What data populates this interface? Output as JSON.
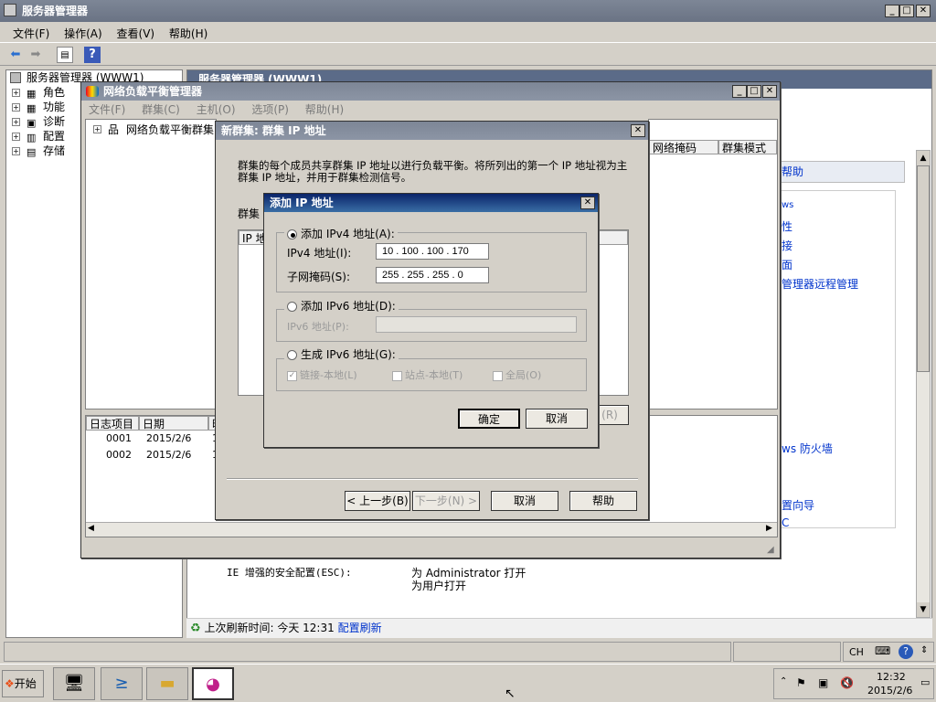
{
  "main_window": {
    "title": "服务器管理器",
    "menus": [
      "文件(F)",
      "操作(A)",
      "查看(V)",
      "帮助(H)"
    ],
    "tree_root": "服务器管理器 (WWW1)",
    "tree_items": [
      "角色",
      "功能",
      "诊断",
      "配置",
      "存储"
    ],
    "content_header": "服务器管理器 (WWW1)",
    "right_links": [
      "帮助",
      "ws",
      "性",
      "接",
      "面",
      "管理器远程管理",
      "ws 防火墙",
      "置向导",
      "C"
    ],
    "ie_esc_label": "IE 增强的安全配置(ESC):",
    "ie_esc_value1": "为 Administrator 打开",
    "ie_esc_value2": "为用户打开",
    "refresh_label": "上次刷新时间: 今天 12:31",
    "refresh_link": "配置刷新"
  },
  "nlb_window": {
    "title": "网络负载平衡管理器",
    "menus": [
      "文件(F)",
      "群集(C)",
      "主机(O)",
      "选项(P)",
      "帮助(H)"
    ],
    "tree_item": "网络负载平衡群集",
    "col_mask": "网络掩码",
    "col_mode": "群集模式",
    "log_headers": [
      "日志项目",
      "日期",
      "时"
    ],
    "log_rows": [
      {
        "id": "0001",
        "date": "2015/2/6",
        "t": "1"
      },
      {
        "id": "0002",
        "date": "2015/2/6",
        "t": "1"
      }
    ]
  },
  "new_cluster_dialog": {
    "title": "新群集:  群集 IP 地址",
    "description": "群集的每个成员共享群集 IP 地址以进行负载平衡。将所列出的第一个 IP 地址视为主群集 IP 地址，并用于群集检测信号。",
    "label_cluster": "群集",
    "list_header": "IP 地",
    "remove_button": "(R)",
    "back_button": "< 上一步(B)",
    "next_button": "下一步(N) >",
    "cancel_button": "取消",
    "help_button": "帮助"
  },
  "add_ip_dialog": {
    "title": "添加 IP 地址",
    "ipv4_option": "添加 IPv4 地址(A):",
    "ipv4_label": "IPv4 地址(I):",
    "ipv4_value": "10  . 100  . 100  . 170",
    "mask_label": "子网掩码(S):",
    "mask_value": "255  . 255  . 255  .  0",
    "ipv6_option": "添加 IPv6 地址(D):",
    "ipv6_label": "IPv6 地址(P):",
    "gen_ipv6_option": "生成 IPv6 地址(G):",
    "chk_link_local": "链接-本地(L)",
    "chk_site_local": "站点-本地(T)",
    "chk_global": "全局(O)",
    "ok_button": "确定",
    "cancel_button": "取消"
  },
  "taskbar": {
    "start": "开始",
    "lang": "CH",
    "time": "12:32",
    "date": "2015/2/6"
  }
}
